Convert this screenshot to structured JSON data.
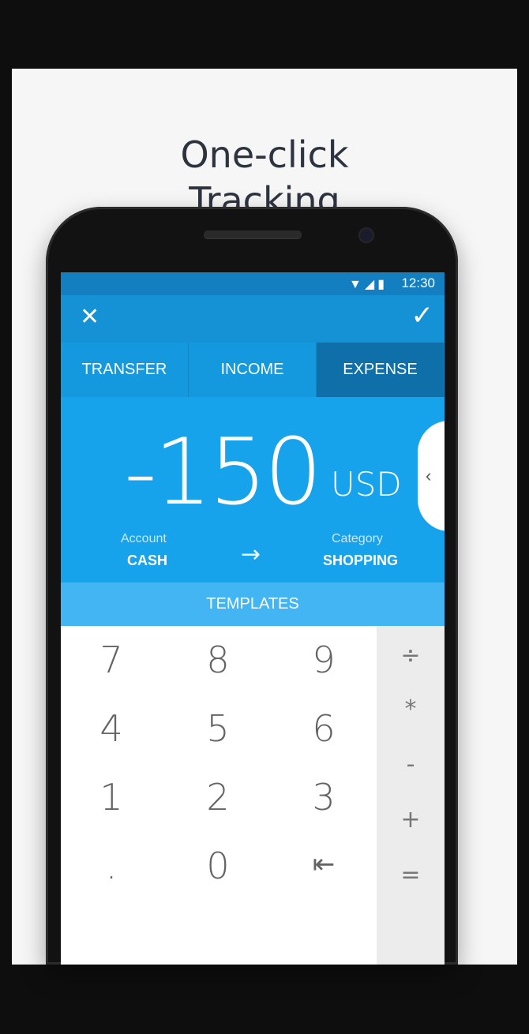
{
  "headline": {
    "line1": "One-click",
    "line2": "Tracking"
  },
  "status_bar": {
    "time": "12:30",
    "icons": "▼◢▮"
  },
  "toolbar": {
    "close_icon": "close-icon",
    "close_glyph": "✕",
    "confirm_icon": "check-icon",
    "confirm_glyph": "✓"
  },
  "tabs": [
    {
      "label": "TRANSFER",
      "active": false
    },
    {
      "label": "INCOME",
      "active": false
    },
    {
      "label": "EXPENSE",
      "active": true
    }
  ],
  "amount": {
    "value": "-150",
    "currency": "USD"
  },
  "account": {
    "label": "Account",
    "value": "CASH"
  },
  "category": {
    "label": "Category",
    "value": "SHOPPING"
  },
  "arrow": "→",
  "side_tab": {
    "glyph": "‹"
  },
  "templates": {
    "label": "TEMPLATES"
  },
  "keypad": {
    "keys": [
      "7",
      "8",
      "9",
      "4",
      "5",
      "6",
      "1",
      "2",
      "3",
      ".",
      "0",
      "⇤"
    ],
    "operators": [
      "÷",
      "*",
      "-",
      "+",
      "="
    ]
  },
  "colors": {
    "accent": "#17a2ec",
    "toolbar": "#1591d6",
    "active_tab": "#0f6fa8",
    "templates_bar": "#44b5f3"
  }
}
